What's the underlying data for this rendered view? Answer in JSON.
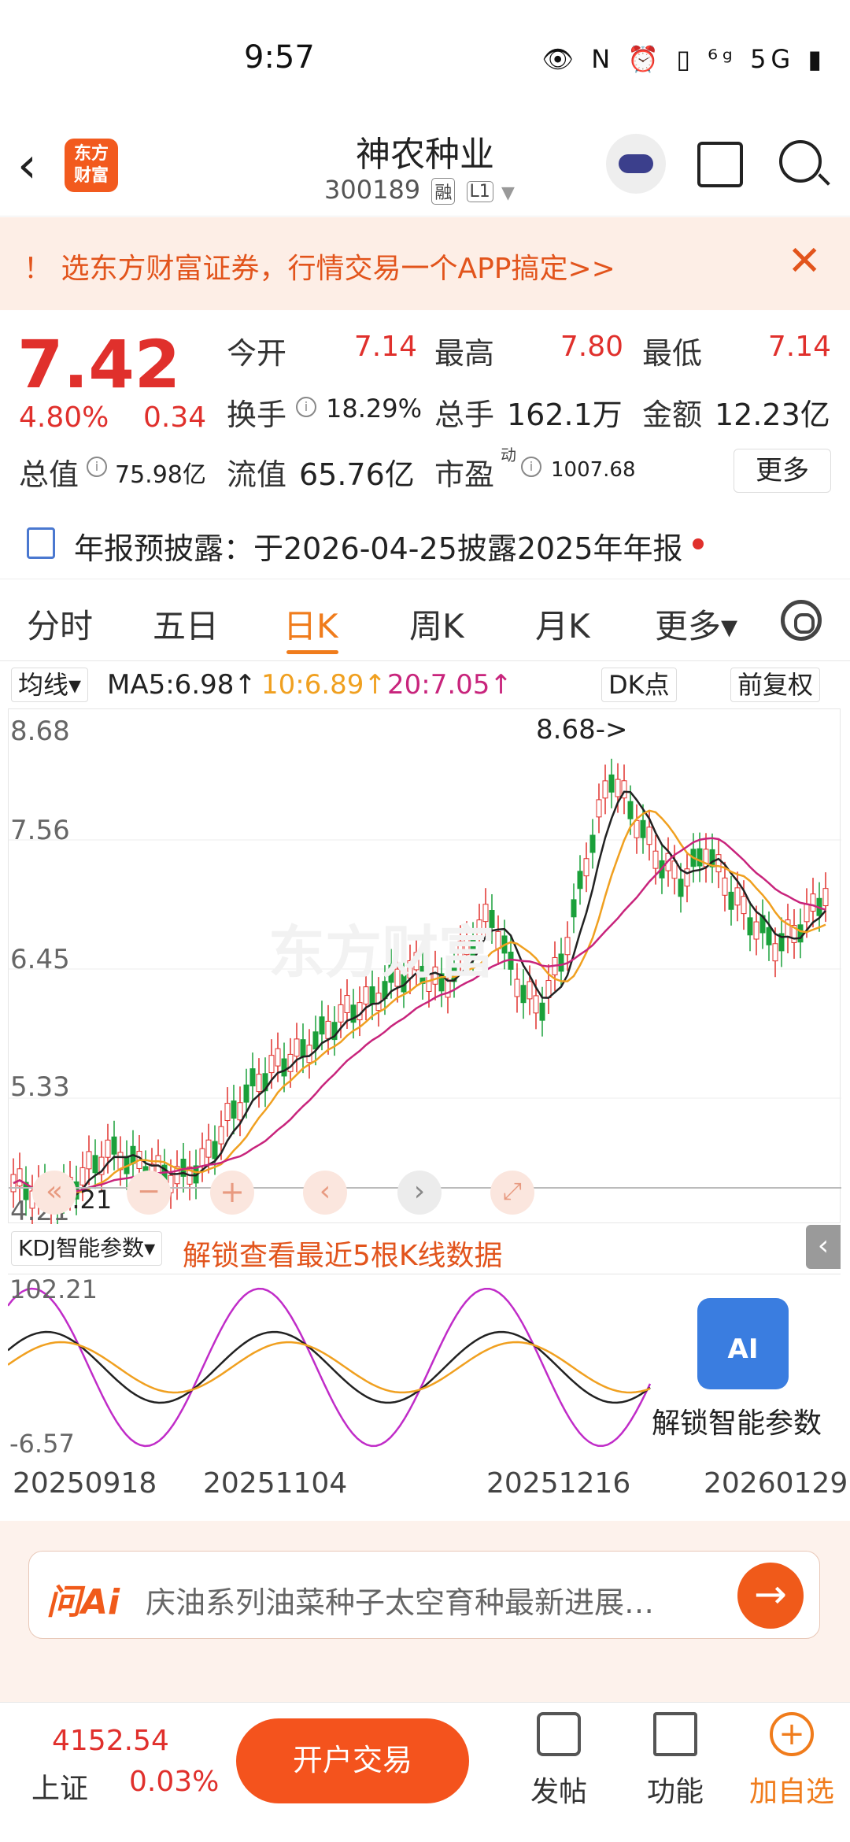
{
  "status_bar": {
    "time": "9:57",
    "icons_text": "👁 N ⏰ ▯ ⁶ᵍ 5G ▮"
  },
  "header": {
    "back_icon": "‹",
    "logo_text": "东方\n财富",
    "stock_name": "神农种业",
    "stock_code": "300189",
    "tag1": "融",
    "tag2": "L1"
  },
  "banner": {
    "text": "！ 选东方财富证券，行情交易一个APP搞定>>",
    "close": "✕"
  },
  "quote": {
    "price": "7.42",
    "change_pct": "4.80%",
    "change_amt": "0.34",
    "open_label": "今开",
    "open_val": "7.14",
    "high_label": "最高",
    "high_val": "7.80",
    "low_label": "最低",
    "low_val": "7.14",
    "turnover_label": "换手",
    "turnover_val": "18.29%",
    "volume_label": "总手",
    "volume_val": "162.1万",
    "amount_label": "金额",
    "amount_val": "12.23亿",
    "mktcap_label": "总值",
    "mktcap_val": "75.98亿",
    "float_label": "流值",
    "float_val": "65.76亿",
    "pe_label": "市盈",
    "pe_sup": "动",
    "pe_val": "1007.68",
    "more": "更多"
  },
  "report": {
    "text": "年报预披露：于2026-04-25披露2025年年报"
  },
  "tabs": [
    "分时",
    "五日",
    "日K",
    "周K",
    "月K",
    "更多▾"
  ],
  "ma_bar": {
    "mode": "均线▾",
    "ma5": "MA5:6.98↑",
    "ma10": "10:6.89↑",
    "ma20": "20:7.05↑",
    "dk": "DK点",
    "fq": "前复权"
  },
  "kchart": {
    "y_labels": [
      "8.68",
      "7.56",
      "6.45",
      "5.33",
      "4.21"
    ],
    "high_marker": "8.68->",
    "low_marker": "4.21",
    "watermark": "东方财富"
  },
  "kdj": {
    "selector": "KDJ智能参数▾",
    "unlock_text": "解锁查看最近5根K线数据",
    "y_top": "102.21",
    "y_bottom": "-6.57",
    "ai_label": "AI",
    "unlock_param": "解锁智能参数"
  },
  "dates": [
    "20250918",
    "20251104",
    "20251216",
    "20260129"
  ],
  "ai_bar": {
    "logo": "问Ai",
    "text": "庆油系列油菜种子太空育种最新进展…",
    "go": "→"
  },
  "bottom": {
    "index_val": "4152.54",
    "index_name": "上证",
    "index_pct": "0.03%",
    "trade": "开户交易",
    "post": "发帖",
    "func": "功能",
    "watch": "加自选"
  },
  "colors": {
    "up": "#e0302c",
    "down": "#1aa03a",
    "accent": "#f07c1c",
    "ma5": "#222222",
    "ma10": "#f0a020",
    "ma20": "#c8247c"
  }
}
